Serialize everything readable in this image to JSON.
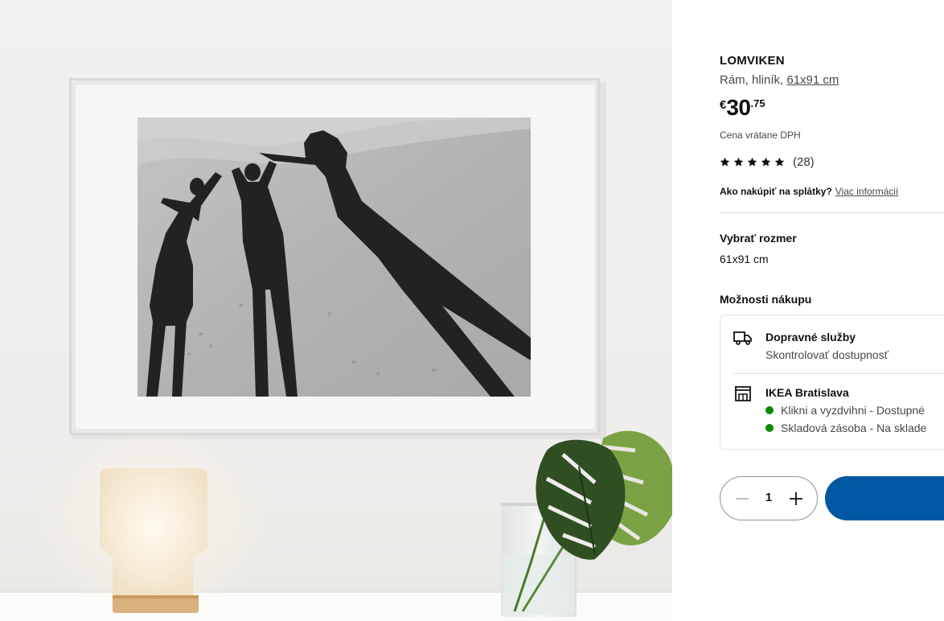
{
  "product": {
    "name": "LOMVIKEN",
    "description_prefix": "Rám, hliník, ",
    "size_link": "61x91 cm",
    "price": {
      "currency": "€",
      "integer": "30",
      "decimal": ".75"
    },
    "vat_note": "Cena vrátane DPH",
    "rating": {
      "stars": 5,
      "count": "(28)"
    },
    "installments": {
      "label": "Ako nakúpiť na splátky?",
      "link": "Viac informácií"
    }
  },
  "size_selector": {
    "title": "Vybrať rozmer",
    "value": "61x91 cm"
  },
  "purchase_options": {
    "title": "Možnosti nákupu",
    "delivery": {
      "title": "Dopravné služby",
      "subtitle": "Skontrolovať dostupnosť",
      "icon": "truck-icon"
    },
    "store": {
      "title": "IKEA Bratislava",
      "icon": "store-icon",
      "availability": [
        {
          "text": "Klikni a vyzdvihni - Dostupné",
          "status_color": "#0a8a00"
        },
        {
          "text": "Skladová zásoba - Na sklade",
          "status_color": "#0a8a00"
        }
      ]
    }
  },
  "quantity": {
    "value": "1"
  },
  "colors": {
    "accent": "#0058a3",
    "available": "#0a8a00"
  }
}
